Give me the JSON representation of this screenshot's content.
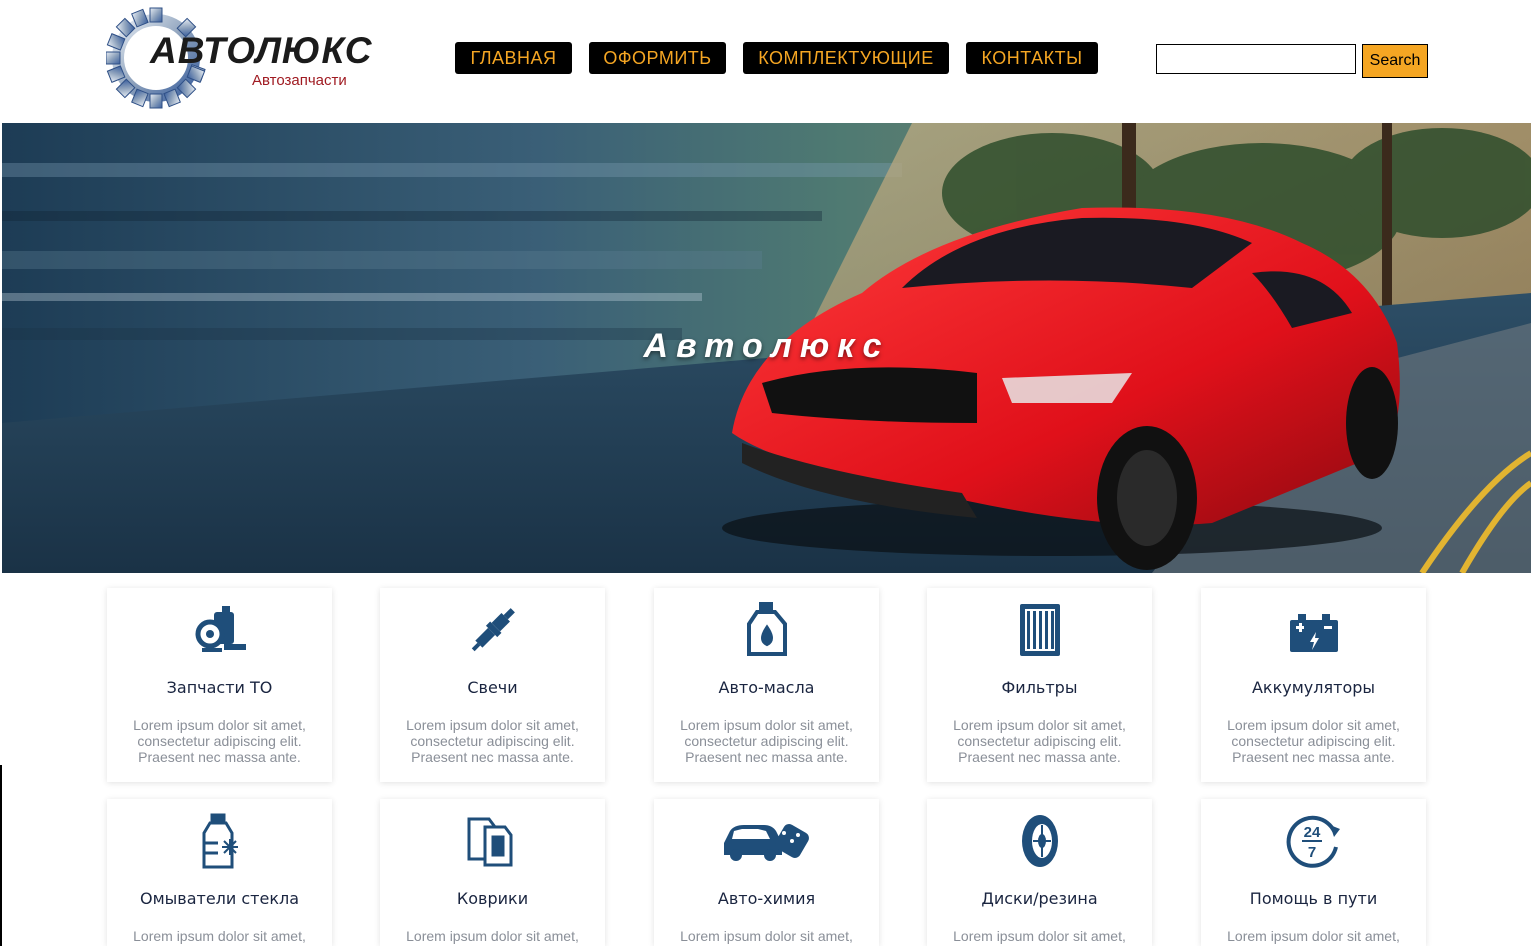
{
  "logo": {
    "title": "АВТОЛЮКС",
    "subtitle": "Автозапчасти"
  },
  "nav": {
    "items": [
      {
        "label": "ГЛАВНАЯ"
      },
      {
        "label": "ОФОРМИТЬ"
      },
      {
        "label": "КОМПЛЕКТУЮЩИЕ"
      },
      {
        "label": "КОНТАКТЫ"
      }
    ]
  },
  "search": {
    "value": "",
    "button_label": "Search"
  },
  "hero": {
    "title": "Автолюкс"
  },
  "colors": {
    "accent": "#f5a623",
    "nav_bg": "#000000",
    "icon": "#1f4e7a",
    "card_title": "#1a2540",
    "card_text": "#8a8f98"
  },
  "cards": [
    {
      "icon": "engine-parts-icon",
      "title": "Запчасти ТО",
      "text": "Lorem ipsum dolor sit amet, consectetur adipiscing elit. Praesent nec massa ante."
    },
    {
      "icon": "spark-plug-icon",
      "title": "Свечи",
      "text": "Lorem ipsum dolor sit amet, consectetur adipiscing elit. Praesent nec massa ante."
    },
    {
      "icon": "oil-canister-icon",
      "title": "Авто-масла",
      "text": "Lorem ipsum dolor sit amet, consectetur adipiscing elit. Praesent nec massa ante."
    },
    {
      "icon": "filter-icon",
      "title": "Фильтры",
      "text": "Lorem ipsum dolor sit amet, consectetur adipiscing elit. Praesent nec massa ante."
    },
    {
      "icon": "battery-icon",
      "title": "Аккумуляторы",
      "text": "Lorem ipsum dolor sit amet, consectetur adipiscing elit. Praesent nec massa ante."
    },
    {
      "icon": "washer-fluid-icon",
      "title": "Омыватели стекла",
      "text": "Lorem ipsum dolor sit amet,"
    },
    {
      "icon": "car-mats-icon",
      "title": "Коврики",
      "text": "Lorem ipsum dolor sit amet,"
    },
    {
      "icon": "car-wash-icon",
      "title": "Авто-химия",
      "text": "Lorem ipsum dolor sit amet,"
    },
    {
      "icon": "tire-icon",
      "title": "Диски/резина",
      "text": "Lorem ipsum dolor sit amet,"
    },
    {
      "icon": "24-7-icon",
      "title": "Помощь в пути",
      "text": "Lorem ipsum dolor sit amet,"
    }
  ]
}
